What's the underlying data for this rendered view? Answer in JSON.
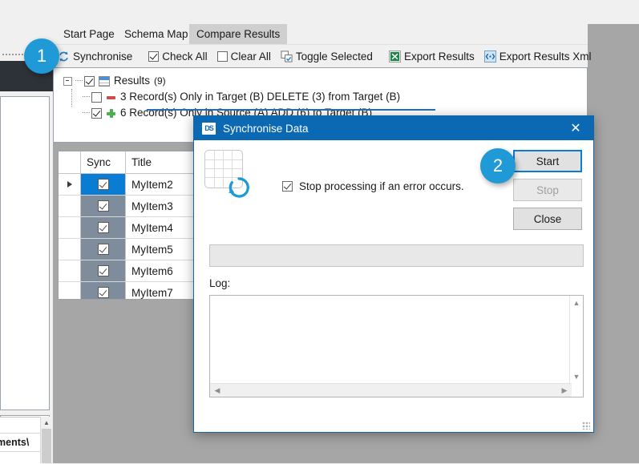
{
  "app": {
    "tabs": [
      {
        "label": "Start Page",
        "active": false
      },
      {
        "label": "Schema Map",
        "active": false
      },
      {
        "label": "Compare Results",
        "active": true
      }
    ],
    "toolbar": {
      "synchronise": "Synchronise",
      "check_all": "Check All",
      "clear_all": "Clear All",
      "toggle_selected": "Toggle Selected",
      "export_results": "Export Results",
      "export_results_xml": "Export Results Xml"
    },
    "tree": {
      "root": {
        "label": "Results",
        "count": "(9)",
        "checked": true
      },
      "children": [
        {
          "label": "3 Record(s) Only in Target (B) DELETE (3) from Target (B)",
          "checked": false,
          "kind": "delete"
        },
        {
          "label": "6 Record(s) Only in Source (A) ADD (6) to Target (B)",
          "checked": true,
          "kind": "add"
        }
      ]
    },
    "grid": {
      "columns": [
        "",
        "Sync",
        "Title"
      ],
      "rows": [
        {
          "title": "MyItem2",
          "sync": true,
          "selected": true
        },
        {
          "title": "MyItem3",
          "sync": true,
          "selected": false
        },
        {
          "title": "MyItem4",
          "sync": true,
          "selected": false
        },
        {
          "title": "MyItem5",
          "sync": true,
          "selected": false
        },
        {
          "title": "MyItem6",
          "sync": true,
          "selected": false
        },
        {
          "title": "MyItem7",
          "sync": true,
          "selected": false
        }
      ]
    },
    "left_panel": {
      "path_text": "ments\\"
    }
  },
  "dialog": {
    "title": "Synchronise Data",
    "icon_text": "DS",
    "close_glyph": "✕",
    "stop_on_error": {
      "label": "Stop processing if an error occurs.",
      "checked": true
    },
    "buttons": {
      "start": "Start",
      "stop": "Stop",
      "close": "Close"
    },
    "log_label": "Log:",
    "log_value": ""
  },
  "callouts": [
    {
      "number": "1"
    },
    {
      "number": "2"
    }
  ],
  "colors": {
    "accent_blue": "#0b69b4",
    "badge_blue": "#1f9ad6",
    "selection_blue": "#0a7cd4",
    "grid_cell_gray": "#7e8c9c",
    "backdrop_gray": "#a6a6a6",
    "chrome_gray": "#f0f0f0",
    "add_green": "#4caf50",
    "delete_red": "#d04b4b"
  }
}
